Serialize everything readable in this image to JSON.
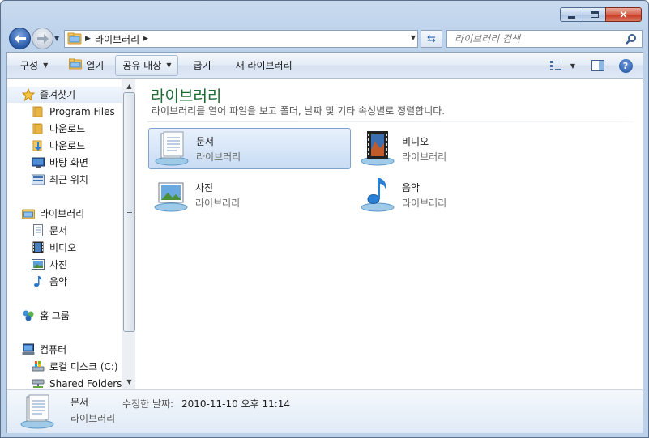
{
  "window": {
    "caption_buttons": {
      "minimize": "minimize",
      "maximize": "maximize",
      "close": "×"
    }
  },
  "address_bar": {
    "crumbs": [
      "라이브러리"
    ],
    "search_placeholder": "라이브러리 검색"
  },
  "toolbar": {
    "organize": "구성",
    "open": "열기",
    "share_with": "공유 대상",
    "burn": "굽기",
    "new_library": "새 라이브러리"
  },
  "sidebar": {
    "favorites": {
      "label": "즐겨찾기",
      "items": [
        "Program Files",
        "다운로드",
        "다운로드",
        "바탕 화면",
        "최근 위치"
      ]
    },
    "libraries": {
      "label": "라이브러리",
      "items": [
        "문서",
        "비디오",
        "사진",
        "음악"
      ]
    },
    "homegroup": {
      "label": "홈 그룹"
    },
    "computer": {
      "label": "컴퓨터",
      "items": [
        "로컬 디스크 (C:)",
        "Shared Folders(W"
      ]
    }
  },
  "main": {
    "title": "라이브러리",
    "subtitle": "라이브러리를 열어 파일을 보고 폴더, 날짜 및 기타 속성별로 정렬합니다.",
    "tiles": [
      {
        "name": "문서",
        "type": "라이브러리",
        "icon": "documents-library-icon"
      },
      {
        "name": "비디오",
        "type": "라이브러리",
        "icon": "videos-library-icon"
      },
      {
        "name": "사진",
        "type": "라이브러리",
        "icon": "pictures-library-icon"
      },
      {
        "name": "음악",
        "type": "라이브러리",
        "icon": "music-library-icon"
      }
    ]
  },
  "details": {
    "name": "문서",
    "type": "라이브러리",
    "modified_label": "수정한 날짜:",
    "modified_value": "2010-11-10 오후 11:14"
  },
  "colors": {
    "header_green": "#1c6b33",
    "selection": "#c8dcf4",
    "chrome": "#bed3ec"
  }
}
